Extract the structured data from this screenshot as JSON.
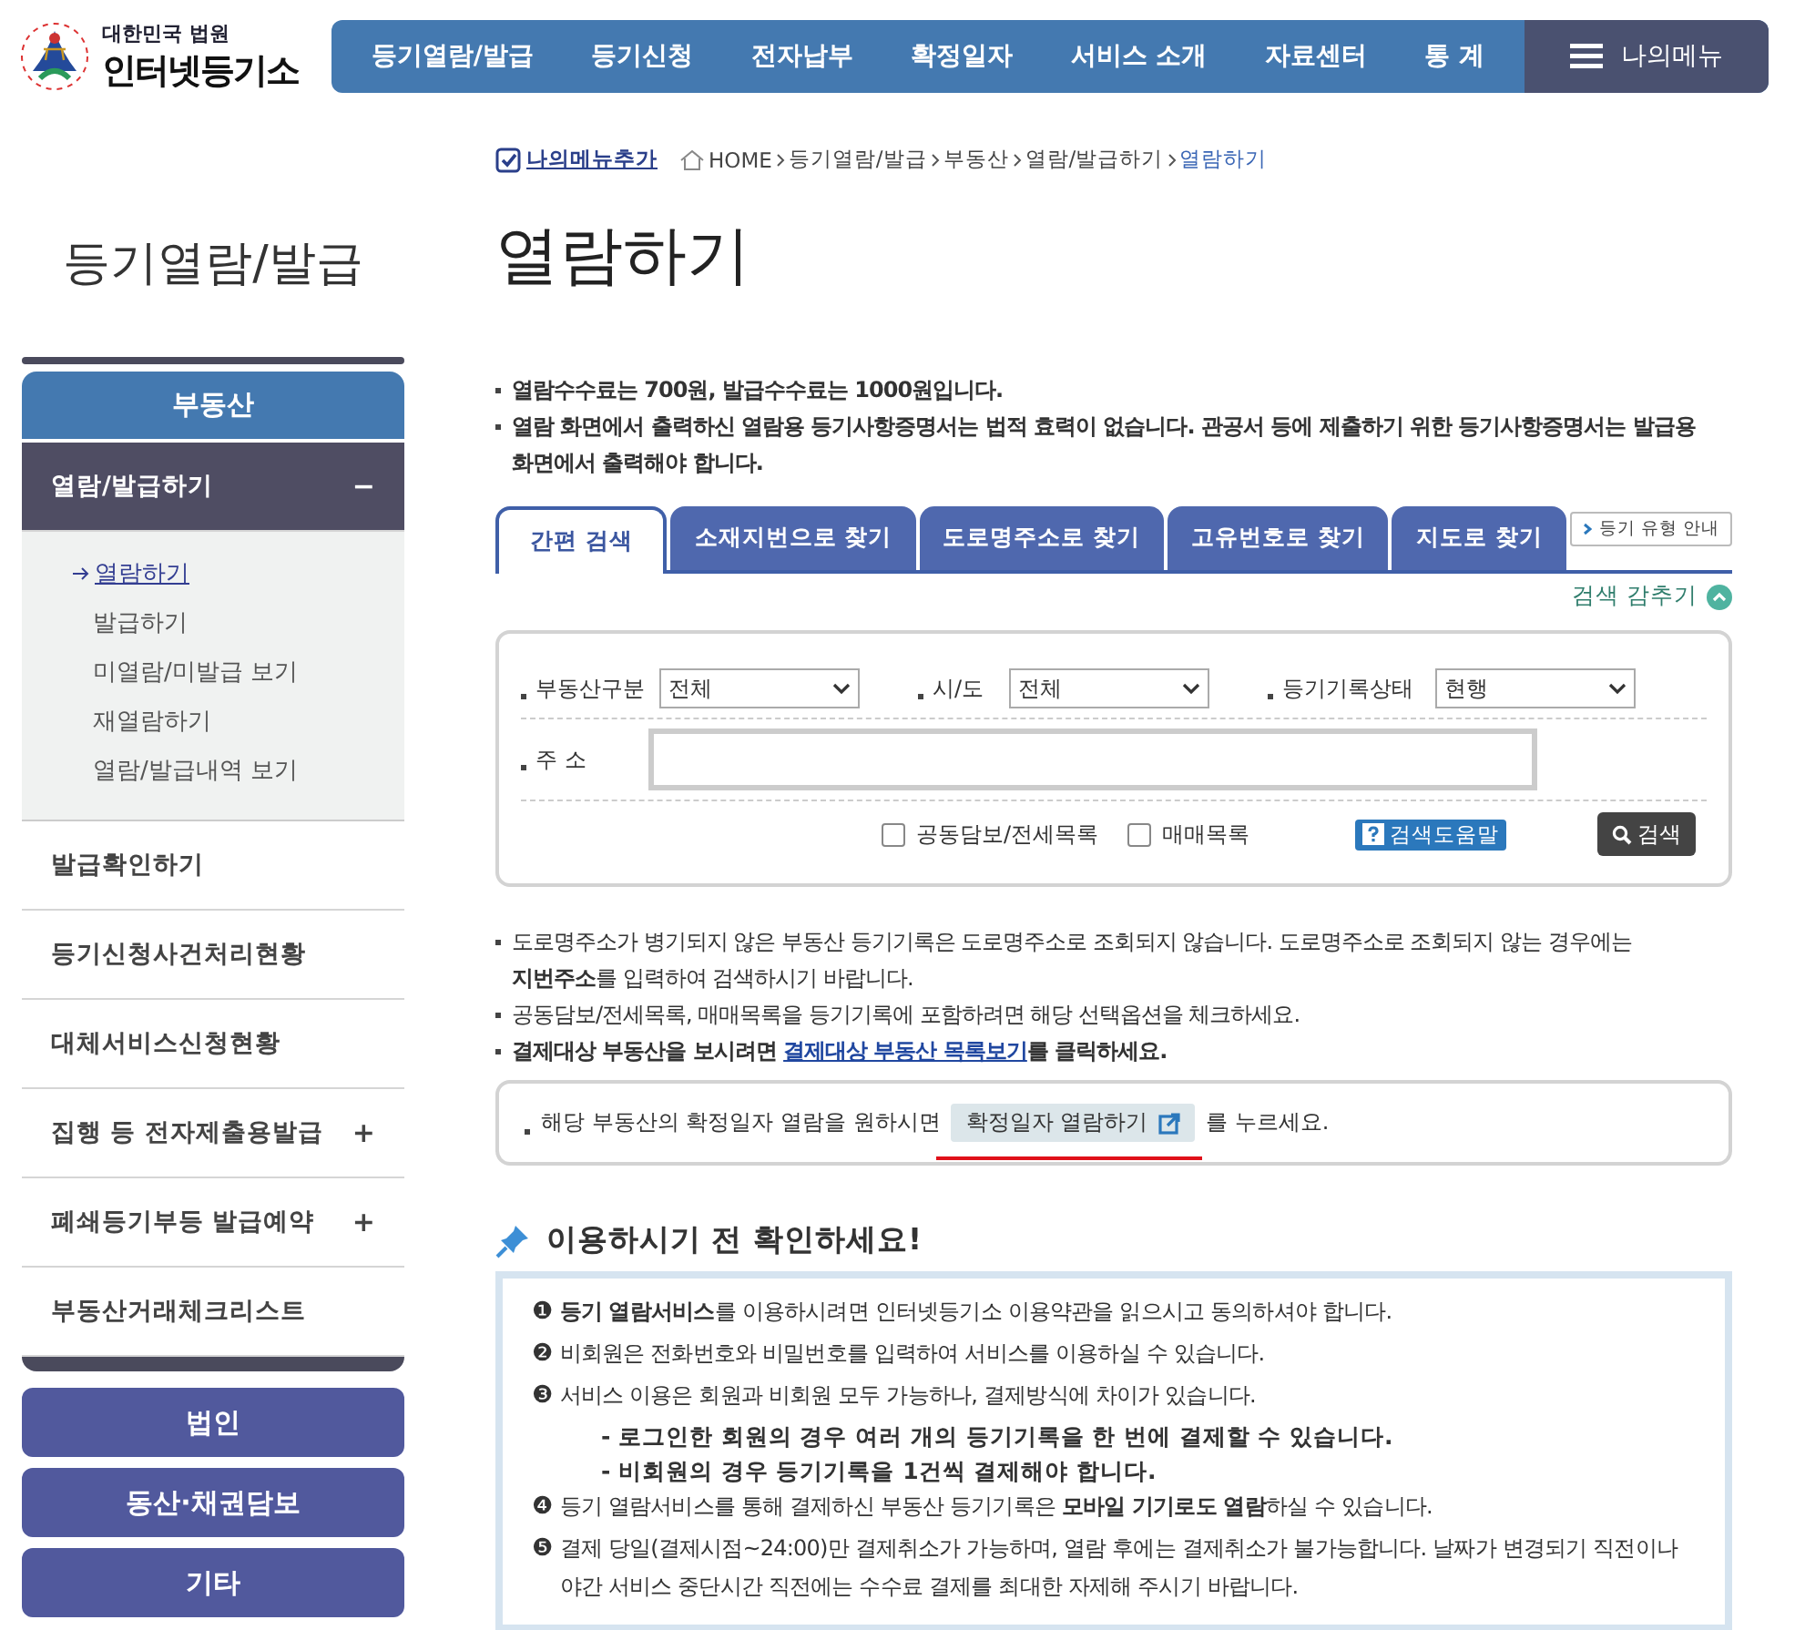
{
  "logo": {
    "subtitle": "대한민국 법원",
    "title": "인터넷등기소"
  },
  "nav": {
    "items": [
      "등기열람/발급",
      "등기신청",
      "전자납부",
      "확정일자",
      "서비스 소개",
      "자료센터",
      "통 계"
    ],
    "my_menu": "나의메뉴"
  },
  "breadcrumb": {
    "add_menu": "나의메뉴추가",
    "items": [
      {
        "label": "HOME",
        "selected": false
      },
      {
        "label": "등기열람/발급",
        "selected": false
      },
      {
        "label": "부동산",
        "selected": false
      },
      {
        "label": "열람/발급하기",
        "selected": false
      },
      {
        "label": "열람하기",
        "selected": true
      }
    ]
  },
  "sidebar": {
    "title": "등기열람/발급",
    "section": "부동산",
    "items": [
      {
        "label": "열람/발급하기",
        "toggle": "−",
        "expanded": true,
        "children": [
          {
            "label": "열람하기",
            "selected": true
          },
          {
            "label": "발급하기",
            "selected": false
          },
          {
            "label": "미열람/미발급 보기",
            "selected": false
          },
          {
            "label": "재열람하기",
            "selected": false
          },
          {
            "label": "열람/발급내역 보기",
            "selected": false
          }
        ]
      },
      {
        "label": "발급확인하기",
        "expanded": false
      },
      {
        "label": "등기신청사건처리현황",
        "expanded": false
      },
      {
        "label": "대체서비스신청현황",
        "expanded": false
      },
      {
        "label": "집행 등 전자제출용발급",
        "toggle": "+",
        "expanded": false
      },
      {
        "label": "폐쇄등기부등 발급예약",
        "toggle": "+",
        "expanded": false
      },
      {
        "label": "부동산거래체크리스트",
        "expanded": false
      }
    ],
    "other_sections": [
      "법인",
      "동산·채권담보",
      "기타"
    ]
  },
  "page_title": "열람하기",
  "fee_notes": [
    "열람수수료는 700원, 발급수수료는 1000원입니다.",
    "열람 화면에서 출력하신 열람용 등기사항증명서는 법적 효력이 없습니다. 관공서 등에 제출하기 위한 등기사항증명서는 발급용 화면에서 출력해야 합니다."
  ],
  "tabs": [
    {
      "label": "간편 검색",
      "selected": true
    },
    {
      "label": "소재지번으로 찾기",
      "selected": false
    },
    {
      "label": "도로명주소로 찾기",
      "selected": false
    },
    {
      "label": "고유번호로 찾기",
      "selected": false
    },
    {
      "label": "지도로 찾기",
      "selected": false
    }
  ],
  "type_guide_button": "등기 유형 안내",
  "hide_search": "검색 감추기",
  "search": {
    "selects": [
      {
        "label": "부동산구분",
        "value": "전체"
      },
      {
        "label": "시/도",
        "value": "전체"
      },
      {
        "label": "등기기록상태",
        "value": "현행"
      }
    ],
    "address_label": "주 소",
    "checkboxes": [
      {
        "label": "공동담보/전세목록",
        "checked": false
      },
      {
        "label": "매매목록",
        "checked": false
      }
    ],
    "help_button": "검색도움말",
    "search_button": "검색"
  },
  "notes": [
    {
      "text": "도로명주소가 병기되지 않은 부동산 등기기록은 도로명주소로 조회되지 않습니다. 도로명주소로 조회되지 않는 경우에는 **지번주소**를 입력하여 검색하시기 바랍니다.",
      "bold": false
    },
    {
      "text": "공동담보/전세목록, 매매목록을 등기기록에 포함하려면 해당 선택옵션을 체크하세요.",
      "bold": false
    },
    {
      "text": "결제대상 부동산을 보시려면",
      "link": "결제대상 부동산 목록보기",
      "after": "를 클릭하세요.",
      "bold": true
    }
  ],
  "notice": {
    "text": "해당 부동산의 확정일자 열람을 원하시면",
    "button": "확정일자 열람하기",
    "after": "를 누르세요."
  },
  "info": {
    "title": "이용하시기 전 확인하세요!",
    "items": [
      {
        "marker": "❶",
        "text": "**등기 열람서비스**를 이용하시려면 인터넷등기소 이용약관을 읽으시고 동의하셔야 합니다."
      },
      {
        "marker": "❷",
        "text": "비회원은 전화번호와 비밀번호를 입력하여 서비스를 이용하실 수 있습니다."
      },
      {
        "marker": "❸",
        "text": "서비스 이용은 회원과 비회원 모두 가능하나, 결제방식에 차이가 있습니다.",
        "subs": [
          "- 로그인한 회원의 경우 여러 개의 등기기록을 한 번에 결제할 수 있습니다.",
          "- 비회원의 경우 등기기록을 1건씩 결제해야 합니다."
        ]
      },
      {
        "marker": "❹",
        "text": "등기 열람서비스를 통해 결제하신 부동산 등기기록은 **모바일 기기로도 열람**하실 수 있습니다."
      },
      {
        "marker": "❺",
        "text": "결제 당일(결제시점~24:00)만 결제취소가 가능하며, 열람 후에는 결제취소가 불가능합니다. 날짜가 변경되기 직전이나 야간 서비스 중단시간 직전에는 수수료 결제를 최대한 자제해 주시기 바랍니다."
      }
    ]
  }
}
